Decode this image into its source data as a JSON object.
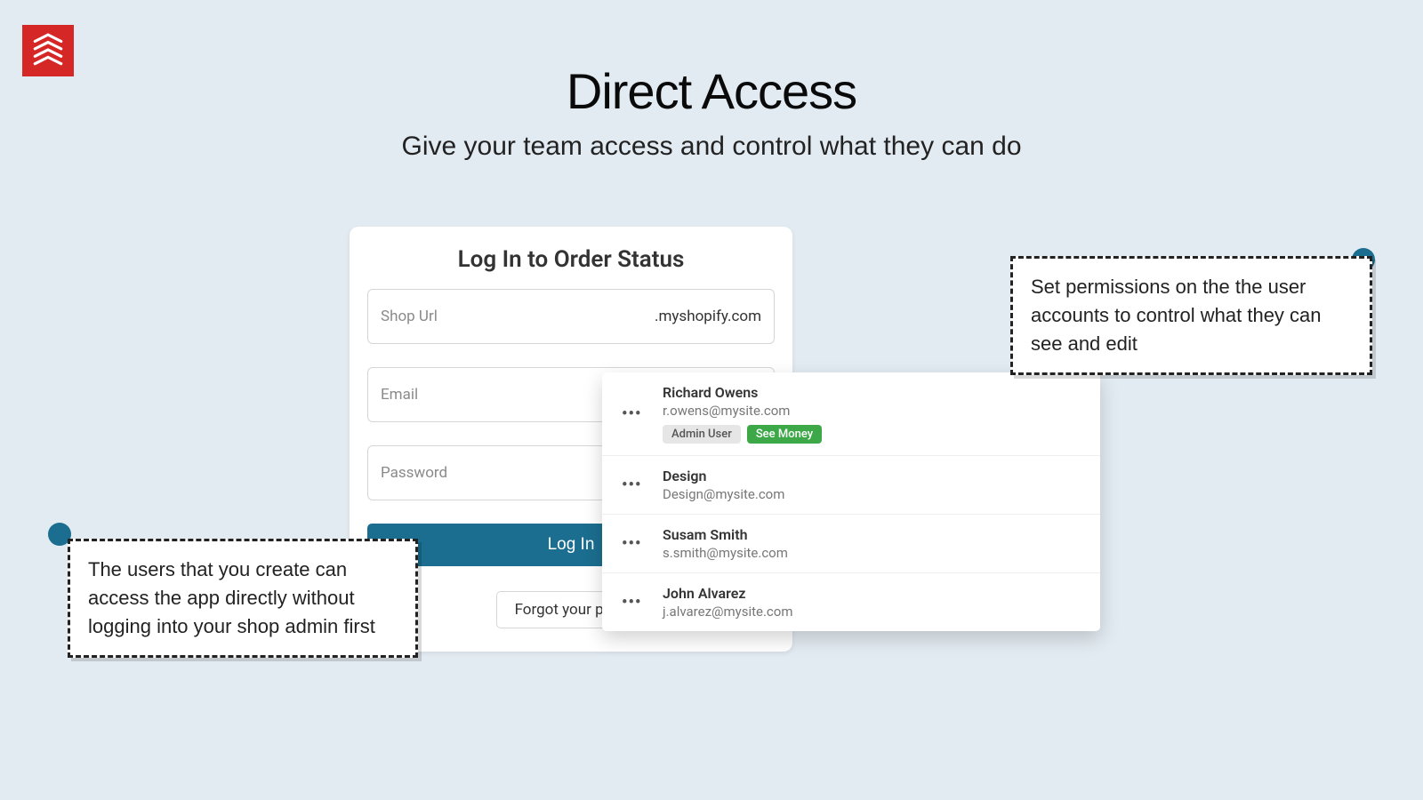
{
  "headline": "Direct Access",
  "subhead": "Give your team access and control what they can do",
  "login": {
    "title": "Log In to Order Status",
    "shop_url_placeholder": "Shop Url",
    "shop_url_suffix": ".myshopify.com",
    "email_placeholder": "Email",
    "password_placeholder": "Password",
    "login_button": "Log In",
    "forgot": "Forgot your pass"
  },
  "users": [
    {
      "name": "Richard Owens",
      "email": "r.owens@mysite.com",
      "badges": [
        {
          "label": "Admin User",
          "type": "admin"
        },
        {
          "label": "See Money",
          "type": "money"
        }
      ]
    },
    {
      "name": "Design",
      "email": "Design@mysite.com",
      "badges": []
    },
    {
      "name": "Susam Smith",
      "email": "s.smith@mysite.com",
      "badges": []
    },
    {
      "name": "John Alvarez",
      "email": "j.alvarez@mysite.com",
      "badges": []
    }
  ],
  "callout_left": "The users that you create can access the app directly without logging into your shop admin first",
  "callout_right": "Set permissions on the the user accounts to control what they can see and edit",
  "colors": {
    "accent": "#1b6e8f",
    "logo_bg": "#d62727",
    "badge_money": "#3ca847"
  }
}
